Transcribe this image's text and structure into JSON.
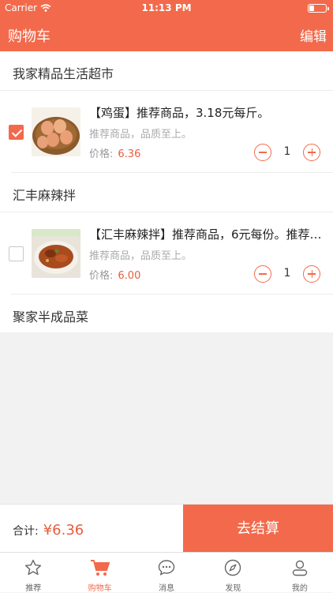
{
  "status": {
    "carrier": "Carrier",
    "time": "11:13 PM"
  },
  "nav": {
    "title": "购物车",
    "edit": "编辑"
  },
  "shops": [
    {
      "name": "我家精品生活超市",
      "item": {
        "title": "【鸡蛋】推荐商品，3.18元每斤。",
        "desc": "推荐商品，品质至上。",
        "price_label": "价格:",
        "price": "6.36",
        "qty": "1",
        "checked": true
      }
    },
    {
      "name": "汇丰麻辣拌",
      "item": {
        "title": "【汇丰麻辣拌】推荐商品，6元每份。推荐商品",
        "desc": "推荐商品，品质至上。",
        "price_label": "价格:",
        "price": "6.00",
        "qty": "1",
        "checked": false
      }
    },
    {
      "name": "聚家半成品菜"
    }
  ],
  "footer": {
    "total_label": "合计:",
    "total": "¥6.36",
    "checkout": "去结算"
  },
  "tabs": [
    {
      "label": "推荐",
      "icon": "star-icon"
    },
    {
      "label": "购物车",
      "icon": "cart-icon",
      "active": true
    },
    {
      "label": "消息",
      "icon": "message-icon"
    },
    {
      "label": "发现",
      "icon": "compass-icon"
    },
    {
      "label": "我的",
      "icon": "profile-icon"
    }
  ],
  "colors": {
    "accent": "#f26a4b",
    "price": "#e85d3d"
  }
}
